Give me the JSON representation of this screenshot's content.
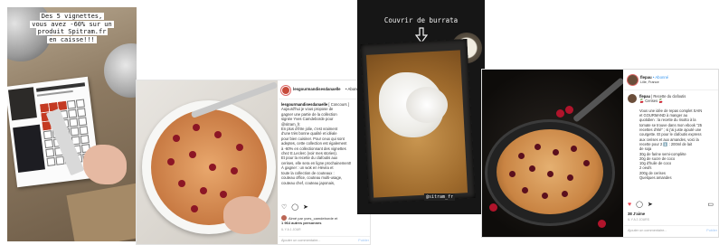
{
  "story1": {
    "caption_lines": [
      "Des 5 vignettes,",
      "vous avez -60% sur un",
      "produit Spitram.fr",
      "en caisse!!!"
    ]
  },
  "post1": {
    "username": "lesgourmandisesdanaelle",
    "follow_label": "• Abonné",
    "caption_username": "lesgourmandisesdanaelle",
    "caption_lines": [
      "[ Concours ]",
      "Aujourd'hui je vous propose de",
      "gagner une partie de la collection",
      "signée Yves Camdeborde pour",
      "@sitram_fr.",
      "En plus d'être jolie, c'est vraiment",
      "d'une très bonne qualité et idéale",
      "pour bien cuisiner. Pour ceux qui sont",
      "adeptes, cette collection est également",
      "à -60% en collectionnant des vignettes",
      "chez E.Leclerc (voir mes stories).",
      "Et pour la recette du clafoutis aux",
      "cerises, elle sera en ligne prochainement!",
      "À gagner : un wok en Hévéa et",
      "toute la collection de couteaux :",
      "couteau office, couteau multi-usage,",
      "couteau chef, couteau japonais,"
    ],
    "likes_text": "Aimé par yves_camdeborde et",
    "likes_count": "1 964 autres personnes",
    "date": "IL Y A 1 JOUR",
    "comment_placeholder": "Ajouter un commentaire...",
    "publish_label": "Publier"
  },
  "story2": {
    "title": "Couvrir de burrata",
    "tag": "@sitram_fr"
  },
  "post2": {
    "username": "flepau",
    "follow_label": "• Abonné",
    "location": "Lille, France",
    "caption_username": "flepau",
    "caption_lines": [
      "| Recette du clafoutis",
      "🍒 Cerises 🍒",
      "",
      "Vous une idée de repas complet SAIN",
      "et GOURMAND à manger au",
      "quotidien : la recette du risotto à la",
      "tomate se trouve dans mon ebook \"25",
      "recettes d'été\" ; si j'ai juste ajouté une",
      "courgette. Et pour le clafoutis express",
      "aux cerises et aux amandes, voici la",
      "recette pour 2 ⬇️ : 200ml de lait",
      "de soja",
      "30g de farine semi-complète",
      "20g de sucre de coco",
      "10g d'huile de coco",
      "2 oeufs",
      "200g de cerises",
      "Quelques amandes"
    ],
    "likes": "38 J'aime",
    "date": "IL Y A 2 JOURS",
    "comment_placeholder": "Ajouter un commentaire...",
    "publish_label": "Publier"
  },
  "colors": {
    "instagram_link": "#3897f0",
    "heart": "#ed4956",
    "publish_disabled": "#9cc4f5"
  }
}
